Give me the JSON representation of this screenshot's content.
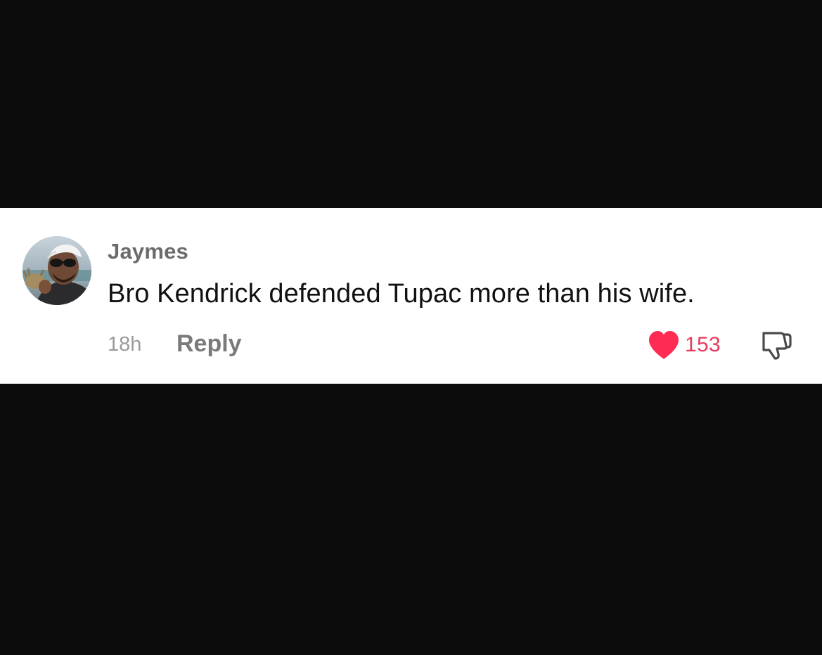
{
  "comment": {
    "username": "Jaymes",
    "text": "Bro Kendrick defended Tupac more than his wife.",
    "timestamp": "18h",
    "reply_label": "Reply",
    "like_count": "153",
    "avatar_icon": "avatar-photo",
    "like_icon": "heart-icon",
    "dislike_icon": "thumbs-down-icon"
  },
  "colors": {
    "background": "#0c0c0d",
    "card": "#ffffff",
    "like_accent": "#fe2c55",
    "like_count": "#e63a5c",
    "username": "#6b6b6e",
    "muted": "#9a9a9d"
  }
}
